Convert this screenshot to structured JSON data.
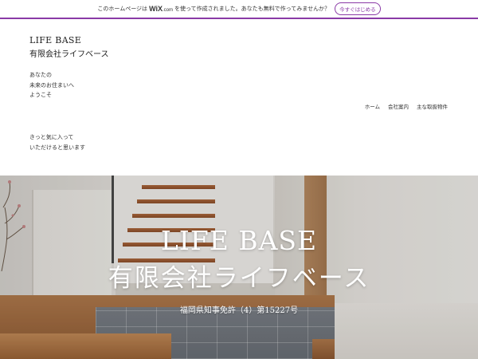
{
  "wix_banner": {
    "text_before": "このホームページは",
    "logo_text": "WiX",
    "logo_suffix": ".com",
    "text_after": "を使って作成されました。あなたも無料で作ってみませんか？",
    "cta_label": "今すぐはじめる",
    "accent_color": "#8a3aa6"
  },
  "brand": {
    "name_en": "LIFE BASE",
    "name_jp": "有限会社ライフベース"
  },
  "tagline_1": [
    "あなたの",
    "未来のお住まいへ",
    "ようこそ"
  ],
  "tagline_2": [
    "きっと気に入って",
    "いただけると思います"
  ],
  "nav": {
    "items": [
      "ホーム",
      "会社案内",
      "主な取扱物件"
    ]
  },
  "hero": {
    "title_en": "LIFE BASE",
    "title_jp": "有限会社ライフベース",
    "license": "福岡県知事免許（4）第15227号"
  }
}
